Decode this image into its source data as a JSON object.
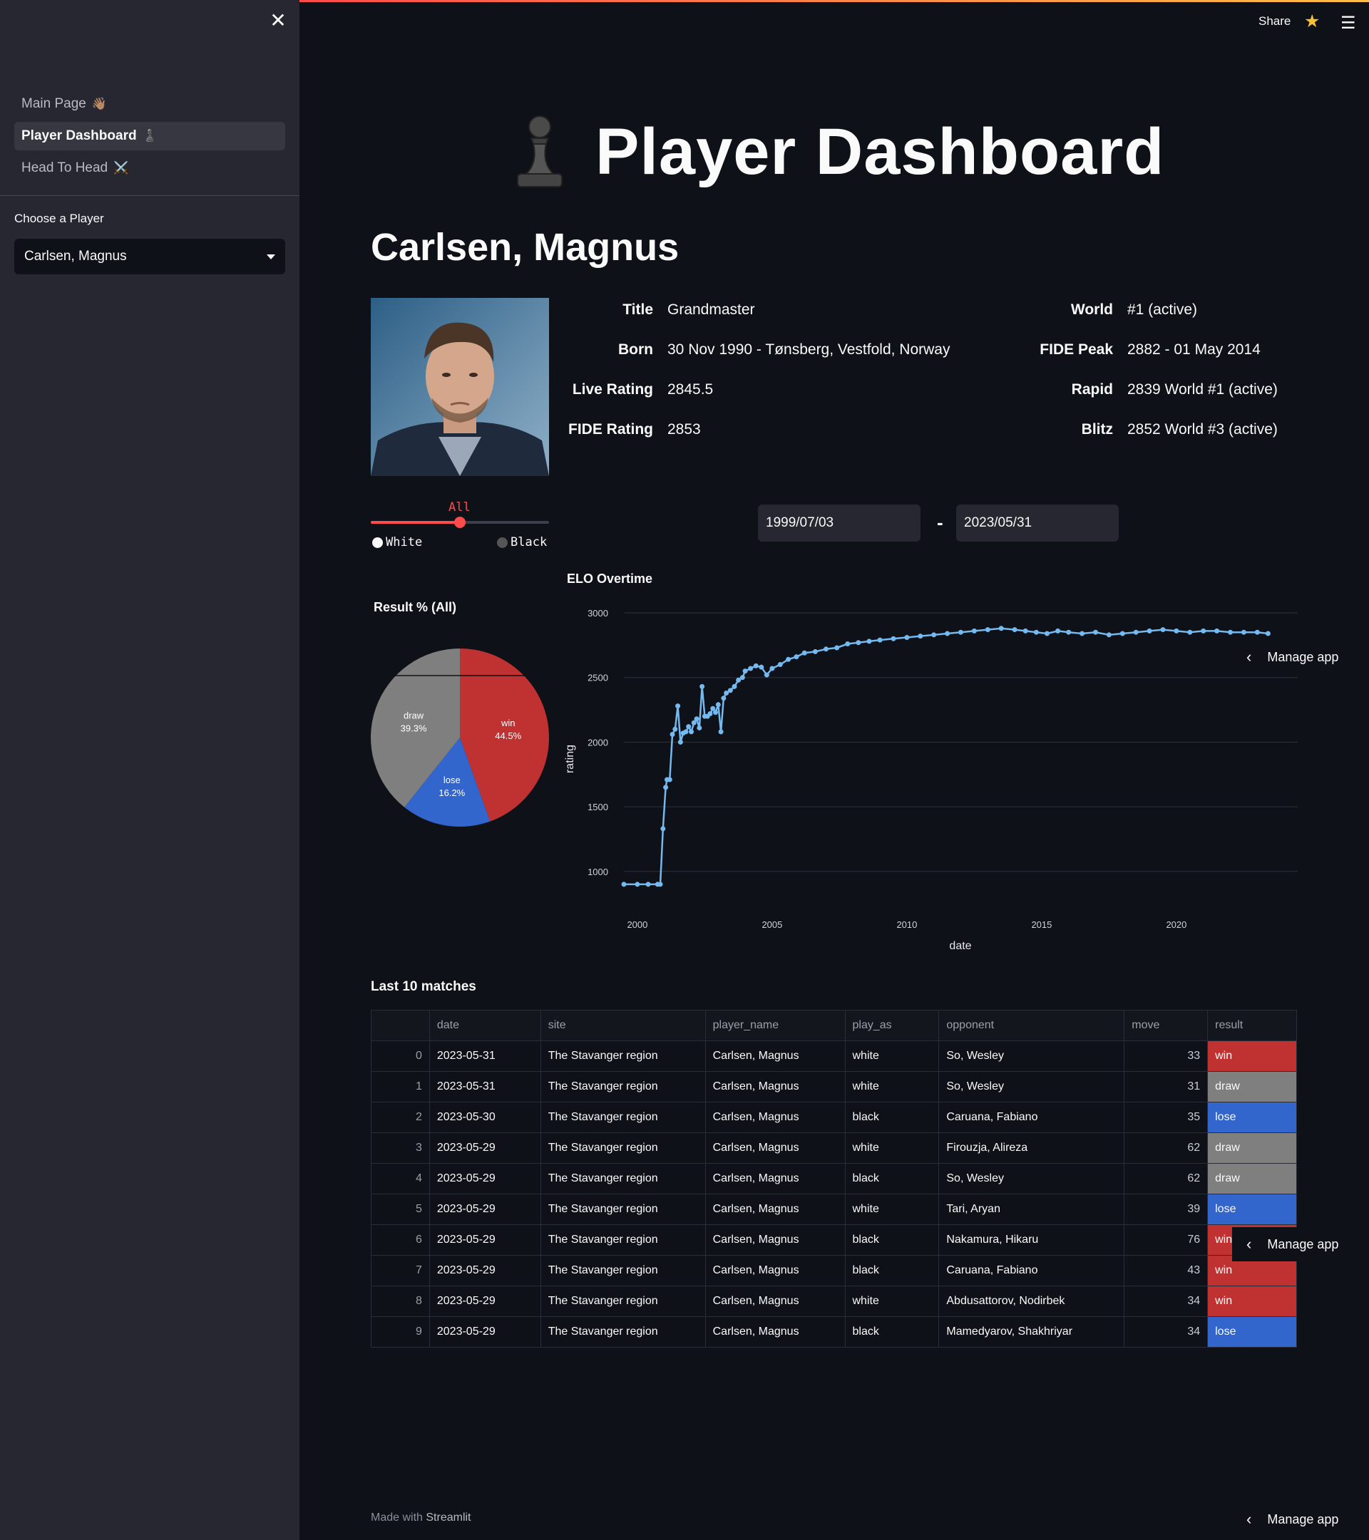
{
  "sidebar": {
    "nav": [
      {
        "label": "Main Page",
        "emoji": "👋🏽",
        "active": false
      },
      {
        "label": "Player Dashboard",
        "emoji": "♟️",
        "active": true
      },
      {
        "label": "Head To Head",
        "emoji": "⚔️",
        "active": false
      }
    ],
    "choose_label": "Choose a Player",
    "selected_player": "Carlsen, Magnus"
  },
  "topbar": {
    "share": "Share",
    "star_icon": "star-icon",
    "menu_icon": "hamburger-icon"
  },
  "header": {
    "title": "Player Dashboard",
    "player_name": "Carlsen, Magnus"
  },
  "info": {
    "left": [
      {
        "label": "Title",
        "value": "Grandmaster"
      },
      {
        "label": "Born",
        "value": "30 Nov 1990 - Tønsberg, Vestfold, Norway"
      },
      {
        "label": "Live Rating",
        "value": "2845.5"
      },
      {
        "label": "FIDE Rating",
        "value": "2853"
      }
    ],
    "right": [
      {
        "label": "World",
        "value": "#1 (active)"
      },
      {
        "label": "FIDE Peak",
        "value": "2882 - 01 May 2014"
      },
      {
        "label": "Rapid",
        "value": "2839 World #1 (active)"
      },
      {
        "label": "Blitz",
        "value": "2852 World #3 (active)"
      }
    ]
  },
  "color_slider": {
    "options": [
      "White",
      "All",
      "Black"
    ],
    "selected": "All",
    "selected_index": 1
  },
  "date_range": {
    "start": "1999/07/03",
    "end": "2023/05/31",
    "separator": "-"
  },
  "colors": {
    "win": "#c03232",
    "lose": "#3366cc",
    "draw": "#7f7f7f",
    "line": "#74b9f0",
    "accent": "#ff4b4b"
  },
  "chart_data": [
    {
      "type": "pie",
      "title": "Result % (All)",
      "labels": [
        "win",
        "lose",
        "draw"
      ],
      "values": [
        44.5,
        16.2,
        39.3
      ],
      "value_labels": [
        "44.5%",
        "16.2%",
        "39.3%"
      ]
    },
    {
      "type": "line",
      "title": "ELO Overtime",
      "xlabel": "date",
      "ylabel": "rating",
      "xticks": [
        "2000",
        "2005",
        "2010",
        "2015",
        "2020"
      ],
      "yticks": [
        "1000",
        "1500",
        "2000",
        "2500",
        "3000"
      ],
      "ylim": [
        850,
        3000
      ],
      "xlim": [
        1999.5,
        2024.5
      ],
      "grid": true,
      "x": [
        1999.5,
        2000.0,
        2000.4,
        2000.75,
        2000.85,
        2000.95,
        2001.05,
        2001.1,
        2001.2,
        2001.3,
        2001.4,
        2001.5,
        2001.6,
        2001.7,
        2001.8,
        2001.9,
        2002.0,
        2002.1,
        2002.2,
        2002.3,
        2002.4,
        2002.5,
        2002.6,
        2002.7,
        2002.8,
        2002.9,
        2003.0,
        2003.1,
        2003.2,
        2003.3,
        2003.45,
        2003.6,
        2003.75,
        2003.9,
        2004.0,
        2004.2,
        2004.4,
        2004.6,
        2004.8,
        2005.0,
        2005.3,
        2005.6,
        2005.9,
        2006.2,
        2006.6,
        2007.0,
        2007.4,
        2007.8,
        2008.2,
        2008.6,
        2009.0,
        2009.5,
        2010.0,
        2010.5,
        2011.0,
        2011.5,
        2012.0,
        2012.5,
        2013.0,
        2013.5,
        2014.0,
        2014.4,
        2014.8,
        2015.2,
        2015.6,
        2016.0,
        2016.5,
        2017.0,
        2017.5,
        2018.0,
        2018.5,
        2019.0,
        2019.5,
        2020.0,
        2020.5,
        2021.0,
        2021.5,
        2022.0,
        2022.5,
        2023.0,
        2023.4
      ],
      "y": [
        900,
        900,
        900,
        900,
        900,
        1330,
        1650,
        1710,
        1710,
        2060,
        2100,
        2280,
        2000,
        2070,
        2080,
        2120,
        2080,
        2150,
        2180,
        2110,
        2430,
        2200,
        2200,
        2220,
        2260,
        2230,
        2290,
        2080,
        2340,
        2380,
        2400,
        2430,
        2480,
        2500,
        2550,
        2570,
        2590,
        2580,
        2520,
        2570,
        2600,
        2640,
        2660,
        2690,
        2700,
        2720,
        2730,
        2760,
        2770,
        2780,
        2790,
        2800,
        2810,
        2820,
        2830,
        2840,
        2850,
        2860,
        2870,
        2880,
        2870,
        2860,
        2850,
        2840,
        2860,
        2850,
        2840,
        2850,
        2830,
        2840,
        2850,
        2860,
        2870,
        2860,
        2850,
        2860,
        2860,
        2850,
        2850,
        2850,
        2840
      ]
    }
  ],
  "table": {
    "title": "Last 10 matches",
    "columns": [
      "",
      "date",
      "site",
      "player_name",
      "play_as",
      "opponent",
      "move",
      "result"
    ],
    "rows": [
      [
        "0",
        "2023-05-31",
        "The Stavanger region",
        "Carlsen, Magnus",
        "white",
        "So, Wesley",
        "33",
        "win"
      ],
      [
        "1",
        "2023-05-31",
        "The Stavanger region",
        "Carlsen, Magnus",
        "white",
        "So, Wesley",
        "31",
        "draw"
      ],
      [
        "2",
        "2023-05-30",
        "The Stavanger region",
        "Carlsen, Magnus",
        "black",
        "Caruana, Fabiano",
        "35",
        "lose"
      ],
      [
        "3",
        "2023-05-29",
        "The Stavanger region",
        "Carlsen, Magnus",
        "white",
        "Firouzja, Alireza",
        "62",
        "draw"
      ],
      [
        "4",
        "2023-05-29",
        "The Stavanger region",
        "Carlsen, Magnus",
        "black",
        "So, Wesley",
        "62",
        "draw"
      ],
      [
        "5",
        "2023-05-29",
        "The Stavanger region",
        "Carlsen, Magnus",
        "white",
        "Tari, Aryan",
        "39",
        "lose"
      ],
      [
        "6",
        "2023-05-29",
        "The Stavanger region",
        "Carlsen, Magnus",
        "black",
        "Nakamura, Hikaru",
        "76",
        "win"
      ],
      [
        "7",
        "2023-05-29",
        "The Stavanger region",
        "Carlsen, Magnus",
        "black",
        "Caruana, Fabiano",
        "43",
        "win"
      ],
      [
        "8",
        "2023-05-29",
        "The Stavanger region",
        "Carlsen, Magnus",
        "white",
        "Abdusattorov, Nodirbek",
        "34",
        "win"
      ],
      [
        "9",
        "2023-05-29",
        "The Stavanger region",
        "Carlsen, Magnus",
        "black",
        "Mamedyarov, Shakhriyar",
        "34",
        "lose"
      ]
    ]
  },
  "manage_app": "Manage app",
  "footer": {
    "prefix": "Made with",
    "brand": "Streamlit"
  }
}
